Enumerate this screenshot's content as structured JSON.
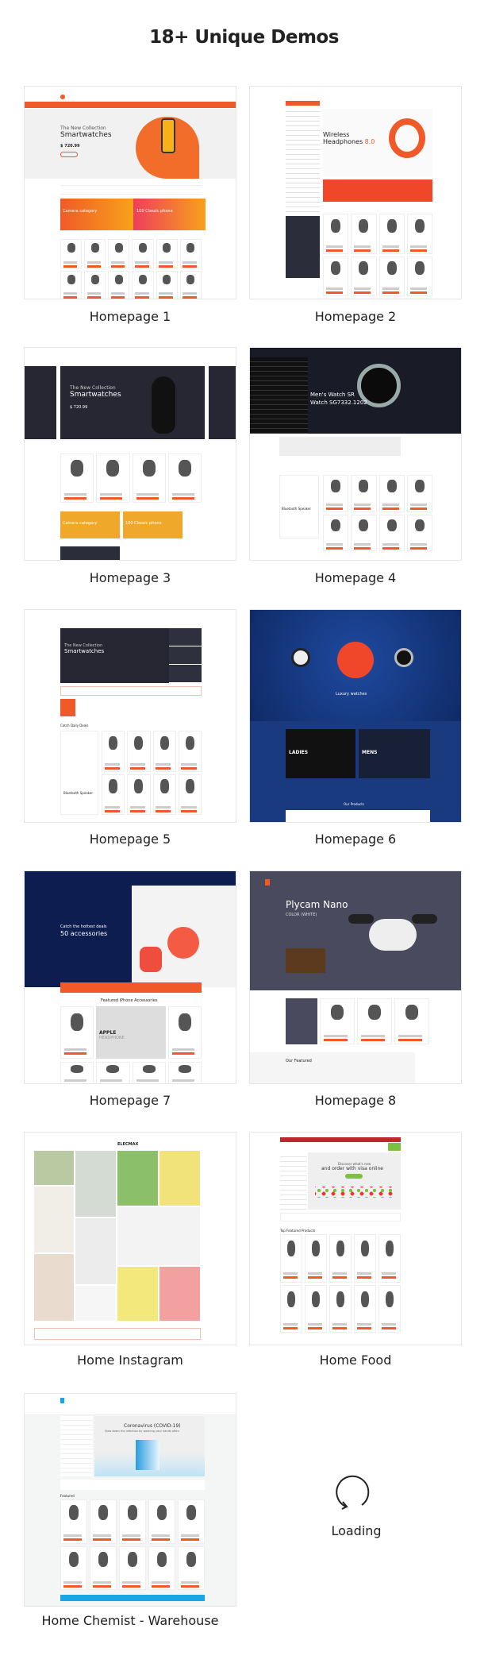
{
  "heading": "18+ Unique Demos",
  "accent_color": "#f05a28",
  "demos": [
    {
      "label": "Homepage 1",
      "hero_small": "The New Collection",
      "hero_big": "Smartwatches",
      "price": "$ 720.99",
      "promo1": "Camera category",
      "promo2": "100 Classic phone"
    },
    {
      "label": "Homepage 2",
      "hero_big": "Wireless",
      "hero_big2": "Headphones",
      "hero_accent": "8.0"
    },
    {
      "label": "Homepage 3",
      "hero_small": "The New Collection",
      "hero_big": "Smartwatches",
      "price": "$ 720.99",
      "promo1": "Camera category",
      "promo2": "100 Classic phone"
    },
    {
      "label": "Homepage 4",
      "hero_big": "Men's Watch SR",
      "hero_big2": "Watch SG7332.1202",
      "product_name": "Bluetooth Speaker"
    },
    {
      "label": "Homepage 5",
      "hero_small": "The New Collection",
      "hero_big": "Smartwatches",
      "section": "Catch Daily Deals",
      "product_name": "Bluetooth Speaker"
    },
    {
      "label": "Homepage 6",
      "hero_big": "Luxury watches",
      "banner1": "LADIES",
      "banner2": "MENS",
      "section": "Our Products"
    },
    {
      "label": "Homepage 7",
      "hero_small": "Catch the hottest deals",
      "hero_big": "50 accessories",
      "section": "Featured iPhone Accessories",
      "promo1": "APPLE",
      "promo2": "HEADPHONE"
    },
    {
      "label": "Homepage 8",
      "hero_big": "Plycam Nano",
      "hero_small": "COLOR (WHITE)",
      "section": "Our Featured"
    },
    {
      "label": "Home Instagram",
      "logo": "ELECMAX"
    },
    {
      "label": "Home Food",
      "hero_small": "Discover what's new",
      "hero_big": "and order with visa online",
      "section": "Top Featured Products"
    },
    {
      "label": "Home Chemist - Warehouse",
      "hero_big": "Coronavirus (COVID-19)",
      "hero_small": "Slow down the infection by washing your hands often",
      "section": "Featured"
    }
  ],
  "loading": {
    "label": "Loading",
    "icon": "refresh-arrow-icon"
  }
}
